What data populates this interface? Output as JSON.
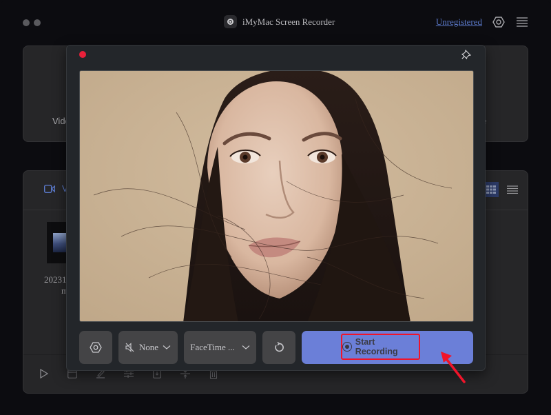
{
  "window": {
    "title": "iMyMac Screen Recorder",
    "unregistered_link": "Unregistered",
    "settings_icon": "hexagon-gear-icon",
    "menu_icon": "hamburger-menu-icon"
  },
  "modes": [
    {
      "label_partial": "Vide"
    },
    {
      "label_partial": ""
    },
    {
      "label_partial": ""
    },
    {
      "label_partial": "ture"
    }
  ],
  "library": {
    "tab_label_partial": "V",
    "tab_icon": "video-camera-icon",
    "view_grid_icon": "grid-view-icon",
    "view_list_icon": "list-view-icon",
    "file": {
      "name_line1": "20231226",
      "name_line2": "m"
    },
    "toolbar_icons": [
      "play-icon",
      "folder-icon",
      "edit-icon",
      "adjust-icon",
      "export-icon",
      "merge-icon",
      "trash-icon"
    ]
  },
  "webcam": {
    "recording_indicator_color": "#e8203a",
    "pin_icon": "pin-icon",
    "controls": {
      "settings_icon": "hexagon-gear-icon",
      "audio_label": "None",
      "audio_icon": "muted-speaker-icon",
      "camera_label": "FaceTime ...",
      "rotate_icon": "rotate-icon",
      "start_label": "Start Recording"
    }
  },
  "colors": {
    "accent": "#6b7fd8",
    "link": "#5a78c8",
    "highlight_box": "#f0142a"
  }
}
